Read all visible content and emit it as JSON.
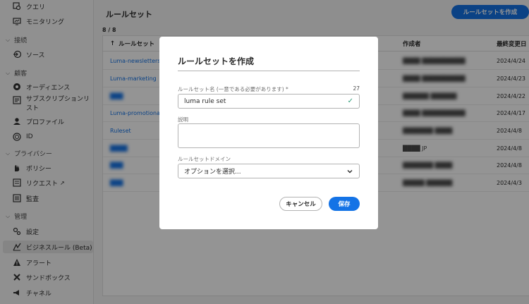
{
  "sidebar": {
    "items": [
      {
        "label": "クエリ",
        "icon": "query-icon"
      },
      {
        "label": "モニタリング",
        "icon": "monitoring-icon"
      },
      {
        "section": "接続"
      },
      {
        "label": "ソース",
        "icon": "sources-icon"
      },
      {
        "section": "顧客"
      },
      {
        "label": "オーディエンス",
        "icon": "audiences-icon"
      },
      {
        "label": "サブスクリプションリスト",
        "icon": "subscription-list-icon"
      },
      {
        "label": "プロファイル",
        "icon": "profile-icon"
      },
      {
        "label": "ID",
        "icon": "identity-icon"
      },
      {
        "section": "プライバシー"
      },
      {
        "label": "ポリシー",
        "icon": "policy-icon"
      },
      {
        "label": "リクエスト",
        "icon": "request-icon"
      },
      {
        "label": "監査",
        "icon": "audit-icon"
      },
      {
        "section": "管理"
      },
      {
        "label": "設定",
        "icon": "settings-icon"
      },
      {
        "label": "ビジネスルール (Beta)",
        "icon": "business-rules-icon",
        "active": true
      },
      {
        "label": "アラート",
        "icon": "alert-icon"
      },
      {
        "label": "サンドボックス",
        "icon": "sandbox-icon"
      },
      {
        "label": "チャネル",
        "icon": "channel-icon"
      }
    ]
  },
  "main": {
    "title": "ルールセット",
    "create_button": "ルールセットを作成",
    "count": "8 / 8",
    "columns": {
      "name": "ルールセット",
      "author": "作成者",
      "modified": "最終変更日"
    },
    "sort_icon": "↑",
    "rows": [
      {
        "name": "Luma-newsletters",
        "author": "████ ██████████",
        "date": "2024/4/24"
      },
      {
        "name": "Luma-marketing",
        "author": "████ ██████████",
        "date": "2024/4/23"
      },
      {
        "name": "███",
        "author": "██████ ██████",
        "date": "2024/4/22"
      },
      {
        "name": "Luma-promotional",
        "author": "████ ██████████",
        "date": "2024/4/17"
      },
      {
        "name": "Ruleset",
        "author": "███████ ████",
        "date": "2024/4/8"
      },
      {
        "name": "████",
        "author": "████ JP",
        "date": "2024/4/8"
      },
      {
        "name": "███",
        "author": "███████ ████",
        "date": "2024/4/8"
      },
      {
        "name": "███",
        "author": "█████ ██████",
        "date": "2024/4/3"
      }
    ]
  },
  "dialog": {
    "title": "ルールセットを作成",
    "name_label": "ルールセット名 (一意である必要があります) *",
    "char_count": "27",
    "name_value": "luma rule set",
    "description_label": "説明",
    "domain_label": "ルールセットドメイン",
    "domain_placeholder": "オプションを選択...",
    "cancel_label": "キャンセル",
    "save_label": "保存"
  },
  "colors": {
    "accent": "#1473e6",
    "valid": "#2d9d78"
  }
}
